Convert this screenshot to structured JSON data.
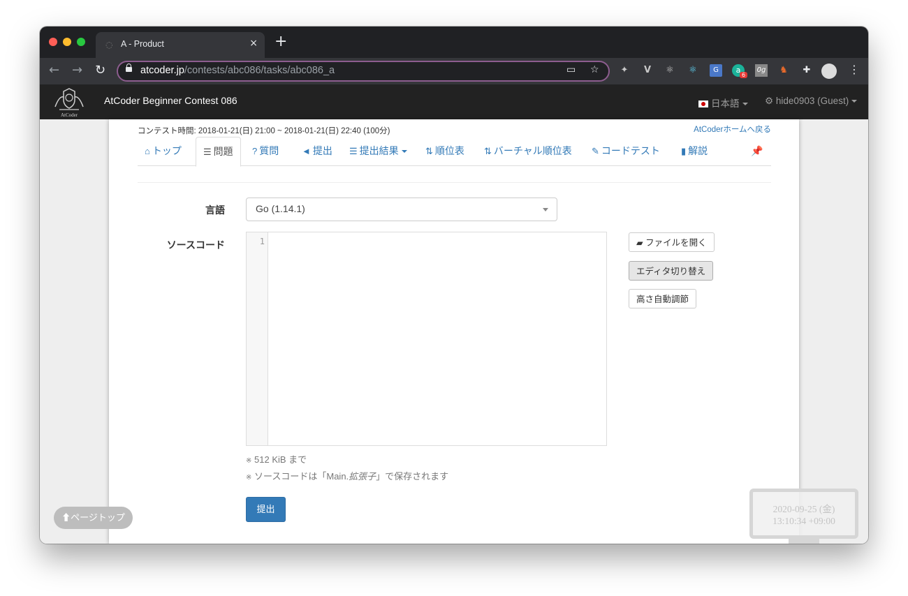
{
  "browser": {
    "tab_title": "A - Product",
    "tab_close": "×",
    "new_tab": "+",
    "url_host": "atcoder.jp",
    "url_path": "/contests/abc086/tasks/abc086_a",
    "extension_badge": "6",
    "extension_og": "0g"
  },
  "navbar": {
    "brand_logo_text": "AtCoder",
    "contest_title": "AtCoder Beginner Contest 086",
    "language": "日本語",
    "user": "hide0903 (Guest)"
  },
  "page": {
    "contest_time": "コンテスト時間: 2018-01-21(日) 21:00 ~ 2018-01-21(日) 22:40 (100分)",
    "home_link": "AtCoderホームへ戻る",
    "tabs": [
      {
        "label": "トップ",
        "icon": "home-icon",
        "glyph": "⌂"
      },
      {
        "label": "問題",
        "icon": "tasks-icon",
        "glyph": "☰"
      },
      {
        "label": "質問",
        "icon": "question-icon",
        "glyph": "?"
      },
      {
        "label": "提出",
        "icon": "send-icon",
        "glyph": "◄"
      },
      {
        "label": "提出結果",
        "icon": "list-icon",
        "glyph": "☰"
      },
      {
        "label": "順位表",
        "icon": "sort-icon",
        "glyph": "⇅"
      },
      {
        "label": "バーチャル順位表",
        "icon": "sort-icon",
        "glyph": "⇅"
      },
      {
        "label": "コードテスト",
        "icon": "wrench-icon",
        "glyph": "✎"
      },
      {
        "label": "解説",
        "icon": "book-icon",
        "glyph": "▮"
      }
    ],
    "active_tab": "問題",
    "pin_icon": "pin-icon",
    "form": {
      "language_label": "言語",
      "language_value": "Go (1.14.1)",
      "source_label": "ソースコード",
      "line_number": "1",
      "open_file_button": "ファイルを開く",
      "toggle_editor_button": "エディタ切り替え",
      "auto_height_button": "高さ自動調節",
      "note_size": "512 KiB まで",
      "note_filename_prefix": "ソースコードは「Main.",
      "note_filename_ext": "拡張子",
      "note_filename_suffix": "」で保存されます",
      "note_mark": "※",
      "submit_button": "提出"
    },
    "page_top_button": "ページトップ"
  },
  "clock_widget": {
    "date": "2020-09-25 (金)",
    "time": "13:10:34 +09:00"
  },
  "colors": {
    "link": "#337ab7",
    "navbar": "#222222",
    "browser_chrome": "#35363a",
    "omnibox_border": "#8d5d8f"
  }
}
